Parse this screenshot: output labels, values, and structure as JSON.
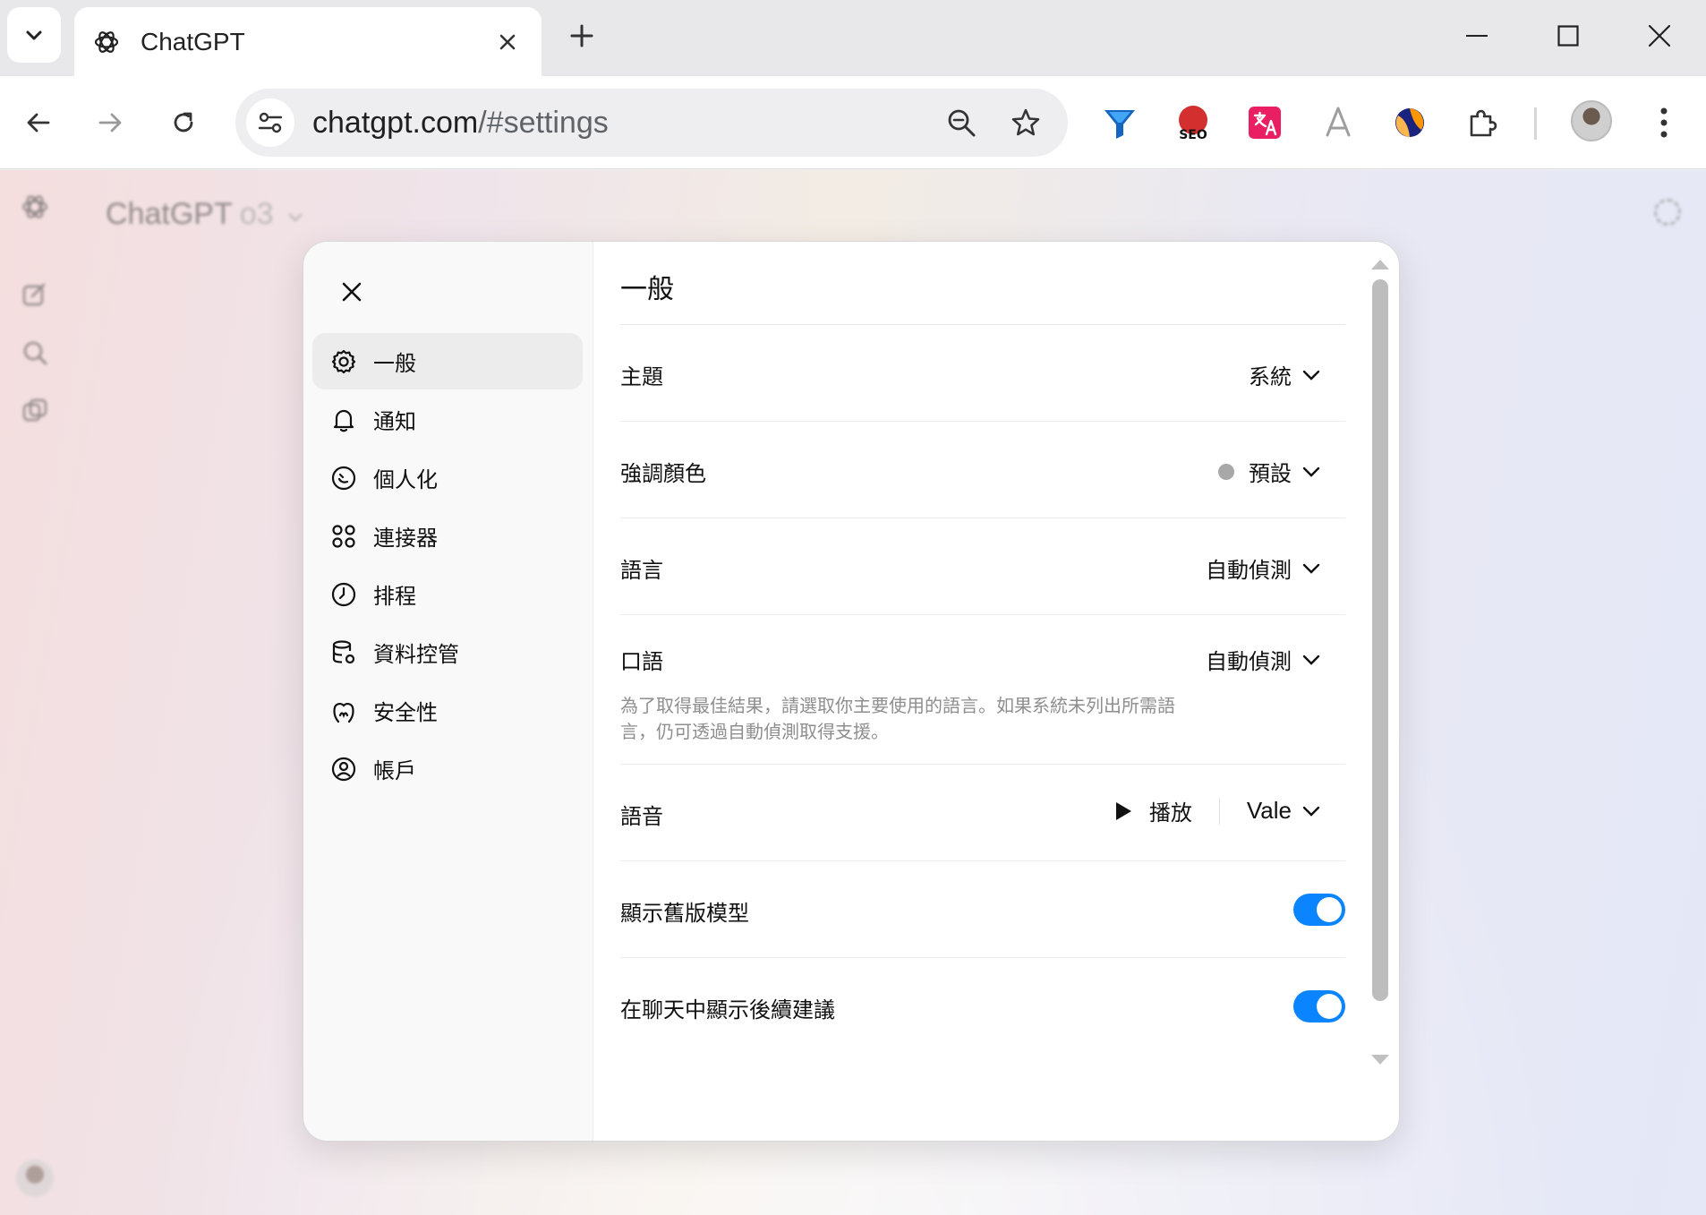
{
  "browser": {
    "tab_title": "ChatGPT",
    "url_host": "chatgpt.com",
    "url_path": "/#settings",
    "extensions": [
      "filter-icon",
      "seo-icon",
      "translate-icon",
      "ruler-icon",
      "circle-logo-icon",
      "puzzle-icon"
    ],
    "seo_label": "SEO"
  },
  "app": {
    "model_name": "ChatGPT",
    "model_version": "o3"
  },
  "settings": {
    "nav": [
      {
        "label": "一般",
        "icon": "gear-icon",
        "active": true
      },
      {
        "label": "通知",
        "icon": "bell-icon"
      },
      {
        "label": "個人化",
        "icon": "personalize-icon"
      },
      {
        "label": "連接器",
        "icon": "connectors-icon"
      },
      {
        "label": "排程",
        "icon": "clock-icon"
      },
      {
        "label": "資料控管",
        "icon": "database-icon"
      },
      {
        "label": "安全性",
        "icon": "security-icon"
      },
      {
        "label": "帳戶",
        "icon": "account-icon"
      }
    ],
    "title": "一般",
    "theme": {
      "label": "主題",
      "value": "系統"
    },
    "accent": {
      "label": "強調顏色",
      "value": "預設",
      "color": "#a8a8a8"
    },
    "language": {
      "label": "語言",
      "value": "自動偵測"
    },
    "spoken": {
      "label": "口語",
      "value": "自動偵測",
      "hint_line1": "為了取得最佳結果，請選取你主要使用的語言。如果系統未列出所需語",
      "hint_line2": "言，仍可透過自動偵測取得支援。"
    },
    "voice": {
      "label": "語音",
      "play_label": "播放",
      "value": "Vale"
    },
    "legacy_models": {
      "label": "顯示舊版模型",
      "enabled": true
    },
    "followup": {
      "label": "在聊天中顯示後續建議",
      "enabled": true
    },
    "accent_color": "#0a84ff"
  }
}
